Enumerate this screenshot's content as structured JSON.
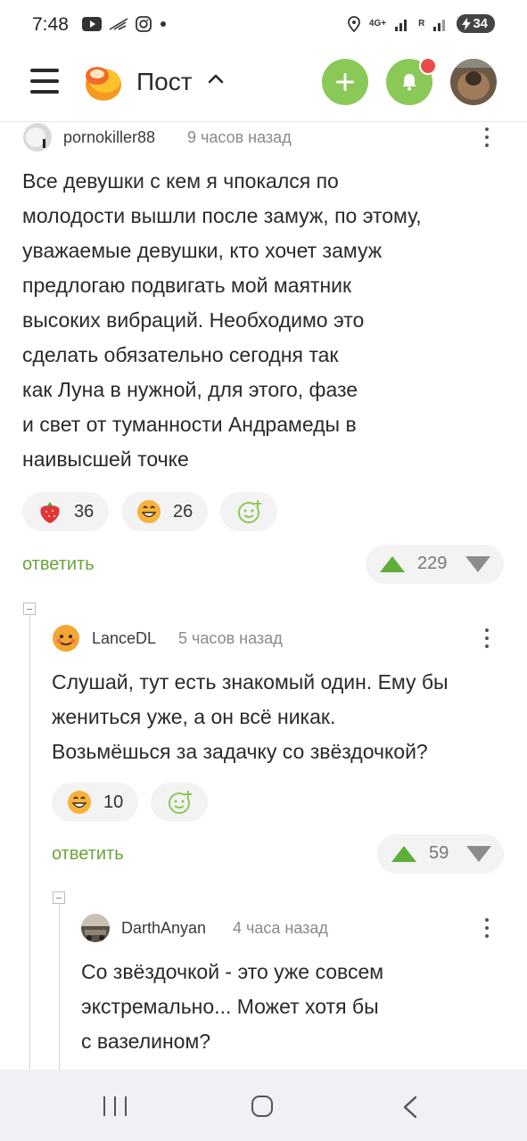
{
  "status_bar": {
    "time": "7:48",
    "network_label": "4G+",
    "sim_label": "R",
    "battery": "34"
  },
  "header": {
    "title": "Пост",
    "icons": [
      "menu-icon",
      "pikabu-logo",
      "chevron-up-icon",
      "plus-icon",
      "bell-icon",
      "user-avatar"
    ],
    "accent_color": "#8ac858",
    "notification_dot_color": "#ec4b4b"
  },
  "comments": [
    {
      "user": "pornokiller88",
      "time": "9 часов назад",
      "text": "Все девушки с кем я чпокался по\nмолодости вышли после замуж, по этому,\nуважаемые девушки, кто хочет замуж\nпредлогаю подвигать мой маятник\nвысоких вибраций. Необходимо это\nсделать обязательно сегодня так\nкак Луна в нужной, для этого, фазе\nи свет от туманности Андрамеды в\nнаивысшей точке",
      "reactions": [
        {
          "icon": "strawberry-icon",
          "count": "36"
        },
        {
          "icon": "grinning-face-icon",
          "count": "26"
        }
      ],
      "reply_label": "ответить",
      "rating": "229"
    },
    {
      "user": "LanceDL",
      "time": "5 часов назад",
      "text": "Слушай, тут есть знакомый один. Ему бы\nжениться уже, а он всё никак.\nВозьмёшься за задачку со звёздочкой?",
      "reactions": [
        {
          "icon": "grinning-face-icon",
          "count": "10"
        }
      ],
      "reply_label": "ответить",
      "rating": "59"
    },
    {
      "user": "DarthAnyan",
      "time": "4 часа назад",
      "text": "Со звёздочкой - это уже совсем\nэкстремально... Может хотя бы\nс вазелином?"
    }
  ],
  "colors": {
    "reply_green": "#6ba33a",
    "upvote_green": "#5fae3c",
    "navbar_bg": "#f2eff6"
  }
}
